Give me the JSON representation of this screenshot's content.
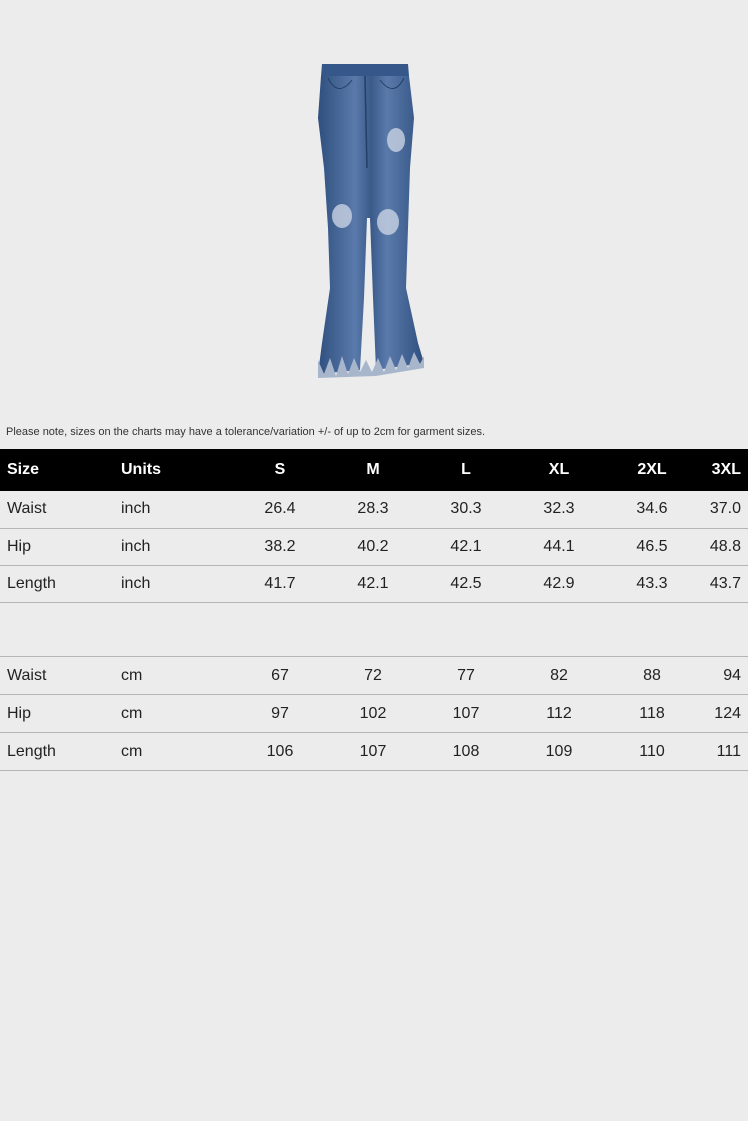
{
  "note": "Please note, sizes on the charts may have a tolerance/variation +/- of up to 2cm for garment sizes.",
  "colors": {
    "background": "#ececec",
    "header_bg": "#000000",
    "header_text": "#ffffff",
    "row_divider": "#b5b5b5",
    "denim_dark": "#2f4f7f",
    "denim_light": "#7d9ac3"
  },
  "inch_table": {
    "headers": [
      "Size",
      "Units",
      "S",
      "M",
      "L",
      "XL",
      "2XL",
      "3XL"
    ],
    "rows": [
      {
        "label": "Waist",
        "unit": "inch",
        "values": [
          "26.4",
          "28.3",
          "30.3",
          "32.3",
          "34.6",
          "37.0"
        ]
      },
      {
        "label": "Hip",
        "unit": "inch",
        "values": [
          "38.2",
          "40.2",
          "42.1",
          "44.1",
          "46.5",
          "48.8"
        ]
      },
      {
        "label": "Length",
        "unit": "inch",
        "values": [
          "41.7",
          "42.1",
          "42.5",
          "42.9",
          "43.3",
          "43.7"
        ]
      }
    ]
  },
  "cm_table": {
    "rows": [
      {
        "label": "Waist",
        "unit": "cm",
        "values": [
          "67",
          "72",
          "77",
          "82",
          "88",
          "94"
        ]
      },
      {
        "label": "Hip",
        "unit": "cm",
        "values": [
          "97",
          "102",
          "107",
          "112",
          "118",
          "124"
        ]
      },
      {
        "label": "Length",
        "unit": "cm",
        "values": [
          "106",
          "107",
          "108",
          "109",
          "110",
          "111"
        ]
      }
    ]
  }
}
